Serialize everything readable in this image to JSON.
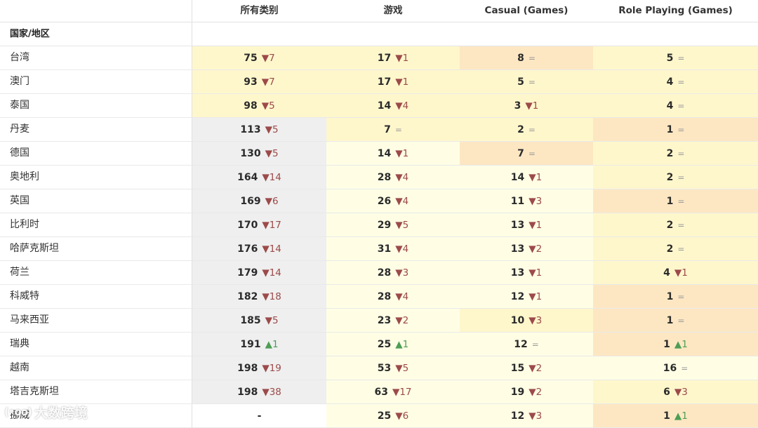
{
  "columns": {
    "region": "国家/地区",
    "all": "所有类别",
    "games": "游戏",
    "casual": "Casual (Games)",
    "rpg": "Role Playing (Games)"
  },
  "colors": {
    "white": "#ffffff",
    "gray": "#efefef",
    "light_yellow": "#fffee5",
    "yellow": "#fff7cc",
    "tan": "#fde7c3",
    "down": "#9c4a4a",
    "up": "#4e9e55",
    "same": "#999999"
  },
  "rows": [
    {
      "country": "台湾",
      "cells": [
        {
          "rank": "75",
          "dir": "down",
          "delta": "7",
          "bg": "yellow"
        },
        {
          "rank": "17",
          "dir": "down",
          "delta": "1",
          "bg": "yellow"
        },
        {
          "rank": "8",
          "dir": "same",
          "delta": "",
          "bg": "tan"
        },
        {
          "rank": "5",
          "dir": "same",
          "delta": "",
          "bg": "yellow"
        }
      ]
    },
    {
      "country": "澳门",
      "cells": [
        {
          "rank": "93",
          "dir": "down",
          "delta": "7",
          "bg": "yellow"
        },
        {
          "rank": "17",
          "dir": "down",
          "delta": "1",
          "bg": "yellow"
        },
        {
          "rank": "5",
          "dir": "same",
          "delta": "",
          "bg": "yellow"
        },
        {
          "rank": "4",
          "dir": "same",
          "delta": "",
          "bg": "yellow"
        }
      ]
    },
    {
      "country": "泰国",
      "cells": [
        {
          "rank": "98",
          "dir": "down",
          "delta": "5",
          "bg": "yellow"
        },
        {
          "rank": "14",
          "dir": "down",
          "delta": "4",
          "bg": "yellow"
        },
        {
          "rank": "3",
          "dir": "down",
          "delta": "1",
          "bg": "yellow"
        },
        {
          "rank": "4",
          "dir": "same",
          "delta": "",
          "bg": "yellow"
        }
      ]
    },
    {
      "country": "丹麦",
      "cells": [
        {
          "rank": "113",
          "dir": "down",
          "delta": "5",
          "bg": "gray"
        },
        {
          "rank": "7",
          "dir": "same",
          "delta": "",
          "bg": "yellow"
        },
        {
          "rank": "2",
          "dir": "same",
          "delta": "",
          "bg": "yellow"
        },
        {
          "rank": "1",
          "dir": "same",
          "delta": "",
          "bg": "tan"
        }
      ]
    },
    {
      "country": "德国",
      "cells": [
        {
          "rank": "130",
          "dir": "down",
          "delta": "5",
          "bg": "gray"
        },
        {
          "rank": "14",
          "dir": "down",
          "delta": "1",
          "bg": "light_yellow"
        },
        {
          "rank": "7",
          "dir": "same",
          "delta": "",
          "bg": "tan"
        },
        {
          "rank": "2",
          "dir": "same",
          "delta": "",
          "bg": "yellow"
        }
      ]
    },
    {
      "country": "奥地利",
      "cells": [
        {
          "rank": "164",
          "dir": "down",
          "delta": "14",
          "bg": "gray"
        },
        {
          "rank": "28",
          "dir": "down",
          "delta": "4",
          "bg": "light_yellow"
        },
        {
          "rank": "14",
          "dir": "down",
          "delta": "1",
          "bg": "light_yellow"
        },
        {
          "rank": "2",
          "dir": "same",
          "delta": "",
          "bg": "yellow"
        }
      ]
    },
    {
      "country": "英国",
      "cells": [
        {
          "rank": "169",
          "dir": "down",
          "delta": "6",
          "bg": "gray"
        },
        {
          "rank": "26",
          "dir": "down",
          "delta": "4",
          "bg": "light_yellow"
        },
        {
          "rank": "11",
          "dir": "down",
          "delta": "3",
          "bg": "light_yellow"
        },
        {
          "rank": "1",
          "dir": "same",
          "delta": "",
          "bg": "tan"
        }
      ]
    },
    {
      "country": "比利时",
      "cells": [
        {
          "rank": "170",
          "dir": "down",
          "delta": "17",
          "bg": "gray"
        },
        {
          "rank": "29",
          "dir": "down",
          "delta": "5",
          "bg": "light_yellow"
        },
        {
          "rank": "13",
          "dir": "down",
          "delta": "1",
          "bg": "light_yellow"
        },
        {
          "rank": "2",
          "dir": "same",
          "delta": "",
          "bg": "yellow"
        }
      ]
    },
    {
      "country": "哈萨克斯坦",
      "cells": [
        {
          "rank": "176",
          "dir": "down",
          "delta": "14",
          "bg": "gray"
        },
        {
          "rank": "31",
          "dir": "down",
          "delta": "4",
          "bg": "light_yellow"
        },
        {
          "rank": "13",
          "dir": "down",
          "delta": "2",
          "bg": "light_yellow"
        },
        {
          "rank": "2",
          "dir": "same",
          "delta": "",
          "bg": "yellow"
        }
      ]
    },
    {
      "country": "荷兰",
      "cells": [
        {
          "rank": "179",
          "dir": "down",
          "delta": "14",
          "bg": "gray"
        },
        {
          "rank": "28",
          "dir": "down",
          "delta": "3",
          "bg": "light_yellow"
        },
        {
          "rank": "13",
          "dir": "down",
          "delta": "1",
          "bg": "light_yellow"
        },
        {
          "rank": "4",
          "dir": "down",
          "delta": "1",
          "bg": "yellow"
        }
      ]
    },
    {
      "country": "科威特",
      "cells": [
        {
          "rank": "182",
          "dir": "down",
          "delta": "18",
          "bg": "gray"
        },
        {
          "rank": "28",
          "dir": "down",
          "delta": "4",
          "bg": "light_yellow"
        },
        {
          "rank": "12",
          "dir": "down",
          "delta": "1",
          "bg": "light_yellow"
        },
        {
          "rank": "1",
          "dir": "same",
          "delta": "",
          "bg": "tan"
        }
      ]
    },
    {
      "country": "马来西亚",
      "cells": [
        {
          "rank": "185",
          "dir": "down",
          "delta": "5",
          "bg": "gray"
        },
        {
          "rank": "23",
          "dir": "down",
          "delta": "2",
          "bg": "light_yellow"
        },
        {
          "rank": "10",
          "dir": "down",
          "delta": "3",
          "bg": "yellow"
        },
        {
          "rank": "1",
          "dir": "same",
          "delta": "",
          "bg": "tan"
        }
      ]
    },
    {
      "country": "瑞典",
      "cells": [
        {
          "rank": "191",
          "dir": "up",
          "delta": "1",
          "bg": "gray"
        },
        {
          "rank": "25",
          "dir": "up",
          "delta": "1",
          "bg": "light_yellow"
        },
        {
          "rank": "12",
          "dir": "same",
          "delta": "",
          "bg": "light_yellow"
        },
        {
          "rank": "1",
          "dir": "up",
          "delta": "1",
          "bg": "tan"
        }
      ]
    },
    {
      "country": "越南",
      "cells": [
        {
          "rank": "198",
          "dir": "down",
          "delta": "19",
          "bg": "gray"
        },
        {
          "rank": "53",
          "dir": "down",
          "delta": "5",
          "bg": "light_yellow"
        },
        {
          "rank": "15",
          "dir": "down",
          "delta": "2",
          "bg": "light_yellow"
        },
        {
          "rank": "16",
          "dir": "same",
          "delta": "",
          "bg": "light_yellow"
        }
      ]
    },
    {
      "country": "塔吉克斯坦",
      "cells": [
        {
          "rank": "198",
          "dir": "down",
          "delta": "38",
          "bg": "gray"
        },
        {
          "rank": "63",
          "dir": "down",
          "delta": "17",
          "bg": "light_yellow"
        },
        {
          "rank": "19",
          "dir": "down",
          "delta": "2",
          "bg": "light_yellow"
        },
        {
          "rank": "6",
          "dir": "down",
          "delta": "3",
          "bg": "yellow"
        }
      ]
    },
    {
      "country": "挪威",
      "cells": [
        {
          "rank": "-",
          "dir": "none",
          "delta": "",
          "bg": "white"
        },
        {
          "rank": "25",
          "dir": "down",
          "delta": "6",
          "bg": "light_yellow"
        },
        {
          "rank": "12",
          "dir": "down",
          "delta": "3",
          "bg": "light_yellow"
        },
        {
          "rank": "1",
          "dir": "up",
          "delta": "1",
          "bg": "tan"
        }
      ]
    }
  ],
  "watermark": {
    "logo": "(•oo)",
    "text": "大数跨境"
  }
}
